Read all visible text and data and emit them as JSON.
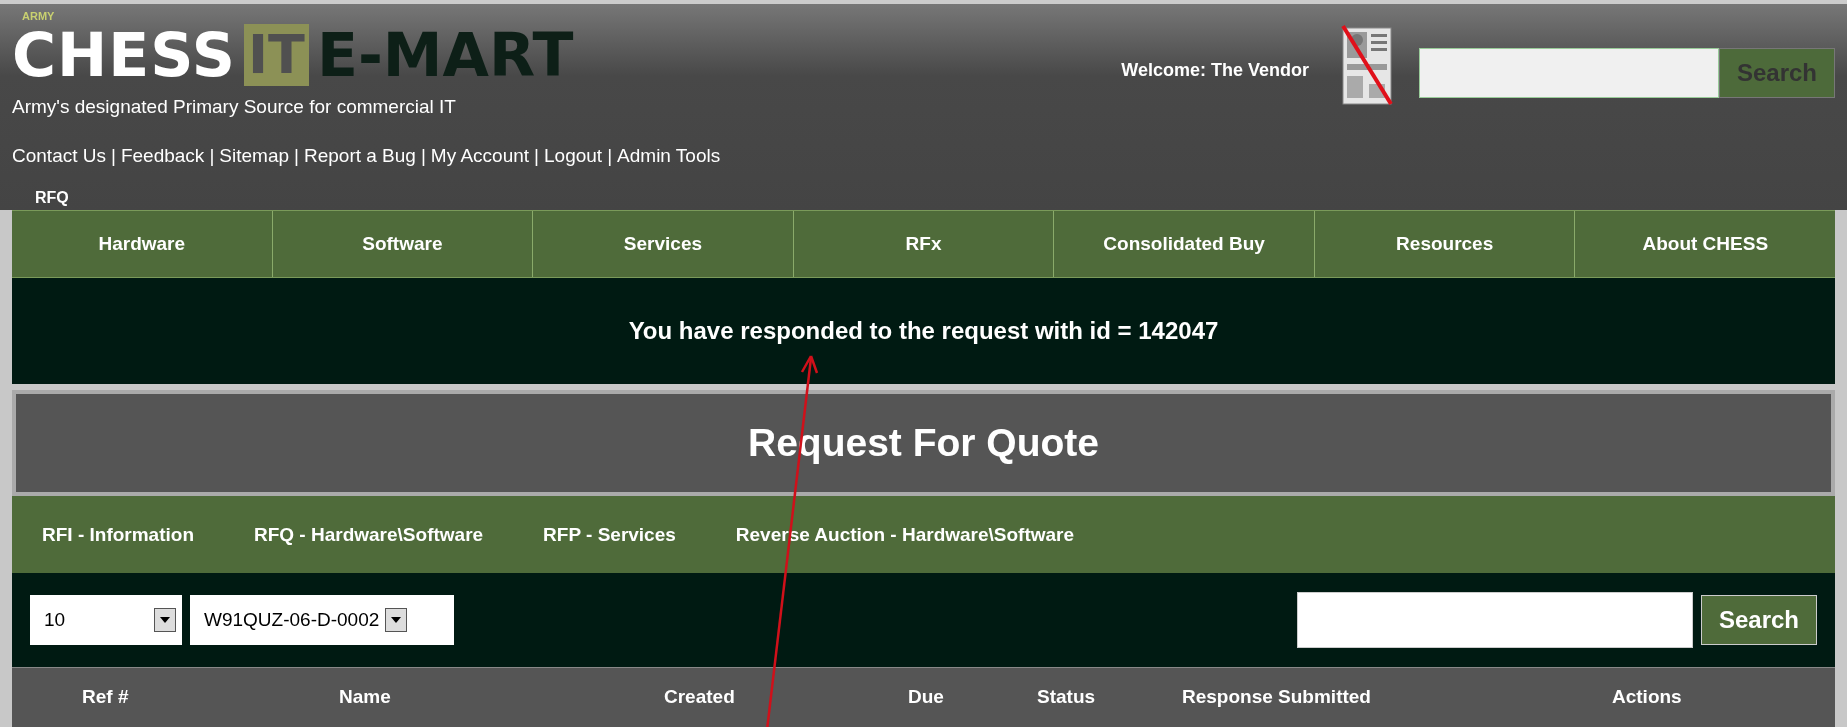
{
  "logo": {
    "small": "ARMY",
    "chess": "CHESS",
    "it": "IT",
    "emart": "E-MART",
    "tagline": "Army's designated Primary Source for commercial IT"
  },
  "welcome": "Welcome: The Vendor",
  "top_search": {
    "button": "Search"
  },
  "link_separator": "|",
  "links": [
    "Contact Us",
    "Feedback",
    "Sitemap",
    "Report a Bug",
    "My Account",
    "Logout",
    "Admin Tools"
  ],
  "breadcrumb": "RFQ",
  "nav": [
    "Hardware",
    "Software",
    "Services",
    "RFx",
    "Consolidated Buy",
    "Resources",
    "About CHESS"
  ],
  "message": "You have responded to the request with id = 142047",
  "page_title": "Request For Quote",
  "tabs": [
    "RFI - Information",
    "RFQ - Hardware\\Software",
    "RFP - Services",
    "Reverse Auction - Hardware\\Software"
  ],
  "page_size": "10",
  "contract": "W91QUZ-06-D-0002",
  "table_search": {
    "button": "Search"
  },
  "columns": [
    "Ref #",
    "Name",
    "Created",
    "Due",
    "Status",
    "Response Submitted",
    "Actions"
  ]
}
